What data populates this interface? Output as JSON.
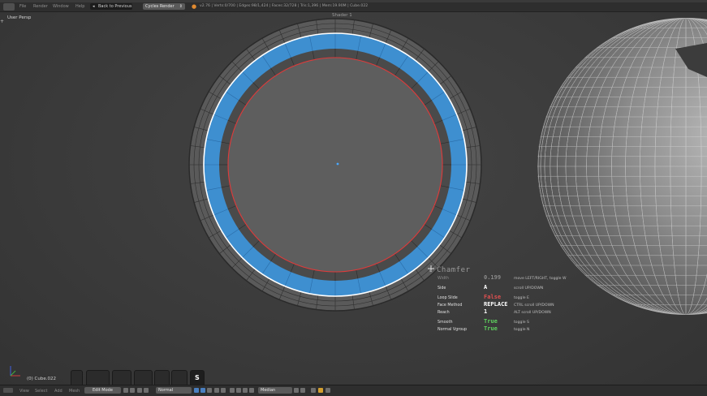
{
  "topbar": {
    "menus": [
      "File",
      "Render",
      "Window",
      "Help"
    ],
    "back_label": "Back to Previous",
    "engine_label": "Cycles Render",
    "stats": "v2.76 | Verts:0/700 | Edges:98/1,424 | Faces:32/728 | Tris:1,396 | Mem:19.90M | Cube.022"
  },
  "viewport": {
    "view_label": "User Persp",
    "object_label": "(0) Cube.022",
    "top_label": "Shader 1",
    "toolbox_label": "S"
  },
  "operator": {
    "title": "Chamfer",
    "rows": [
      {
        "label": "Width",
        "value": "0.199",
        "hint": "move LEFT/RIGHT, toggle W",
        "value_color": "#8a8a8a"
      },
      {
        "label": "Side",
        "value": "A",
        "hint": "scroll UP/DOWN",
        "value_color": "#ffffff"
      },
      {
        "label": "Loop Slide",
        "value": "False",
        "hint": "toggle E",
        "value_color": "#e05050"
      },
      {
        "label": "Face Method",
        "value": "REPLACE",
        "hint": "CTRL scroll UP/DOWN",
        "value_color": "#ffffff"
      },
      {
        "label": "Reach",
        "value": "1",
        "hint": "ALT scroll UP/DOWN",
        "value_color": "#ffffff"
      },
      {
        "label": "Smooth",
        "value": "True",
        "hint": "toggle S",
        "value_color": "#5fd35f"
      },
      {
        "label": "Normal Vgroup",
        "value": "True",
        "hint": "toggle N",
        "value_color": "#5fd35f"
      }
    ]
  },
  "footer": {
    "menus": [
      "View",
      "Select",
      "Add",
      "Mesh"
    ],
    "mode_label": "Edit Mode",
    "shading_label": "Normal",
    "pivot_label": "Median"
  },
  "colors": {
    "selection": "#3f8fd0",
    "edge_highlight": "#ffffff",
    "seam": "#e03a3a",
    "background": "#3a3a3a"
  }
}
